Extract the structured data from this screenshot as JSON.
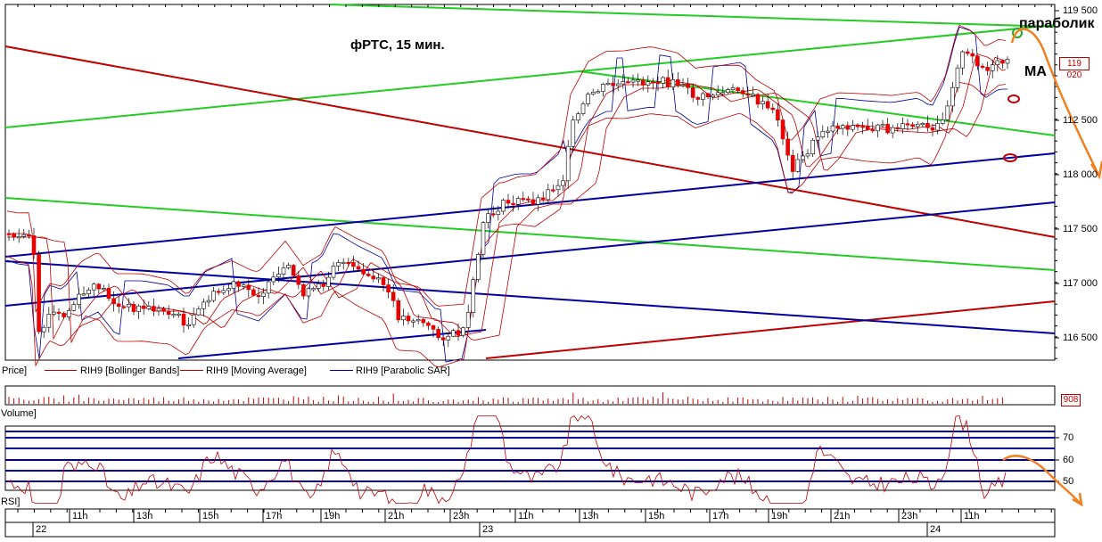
{
  "annotations": {
    "title": "фРТС,  15 мин.",
    "parabolic": "параболик",
    "ma": "MA"
  },
  "price_panel": {
    "label": "Price]",
    "legend": [
      {
        "text": "RIH9 [Bollinger Bands]",
        "color": "#c00000"
      },
      {
        "text": "RIH9 [Moving Average]",
        "color": "#c00000"
      },
      {
        "text": "RIH9 [Parabolic SAR]",
        "color": "#0000a0"
      }
    ],
    "y_ticks": [
      "119 500",
      "112 500",
      "118 000",
      "117 500",
      "117 000",
      "116 500"
    ],
    "current_price": "119 020"
  },
  "volume_panel": {
    "label": "Volume]",
    "current": "908"
  },
  "rsi_panel": {
    "label": "RSI]",
    "y_ticks": [
      "70",
      "60",
      "50"
    ]
  },
  "time_axis": {
    "hour_ticks": [
      "11h",
      "13h",
      "15h",
      "17h",
      "19h",
      "21h",
      "23h",
      "11h",
      "13h",
      "15h",
      "17h",
      "19h",
      "21h",
      "23h",
      "11h"
    ],
    "day_ticks": [
      "22",
      "23",
      "24"
    ]
  },
  "colors": {
    "up_candle": "#ffffff",
    "down_candle": "#e60000",
    "bollinger": "#c00000",
    "sar": "#0000a0",
    "trend_green": "#22cc22",
    "trend_red": "#c00000",
    "trend_blue": "#0000a0",
    "forecast": "#f08020"
  },
  "chart_data": {
    "type": "candlestick",
    "title": "фРТС,  15 мин.",
    "instrument": "RIH9",
    "indicators": [
      "Bollinger Bands",
      "Moving Average",
      "Parabolic SAR",
      "Volume",
      "RSI"
    ],
    "close_approx": [
      {
        "x": "22 11h",
        "y": 116500
      },
      {
        "x": "22 15h",
        "y": 116900
      },
      {
        "x": "22 19h",
        "y": 117000
      },
      {
        "x": "22 23h",
        "y": 116500
      },
      {
        "x": "23 11h",
        "y": 117700
      },
      {
        "x": "23 13h",
        "y": 119000
      },
      {
        "x": "23 15h",
        "y": 119200
      },
      {
        "x": "23 19h",
        "y": 118000
      },
      {
        "x": "23 23h",
        "y": 118500
      },
      {
        "x": "24 11h",
        "y": 119020
      }
    ],
    "last_price": 119020,
    "last_volume": 908,
    "rsi_levels": [
      70,
      60,
      50
    ]
  }
}
